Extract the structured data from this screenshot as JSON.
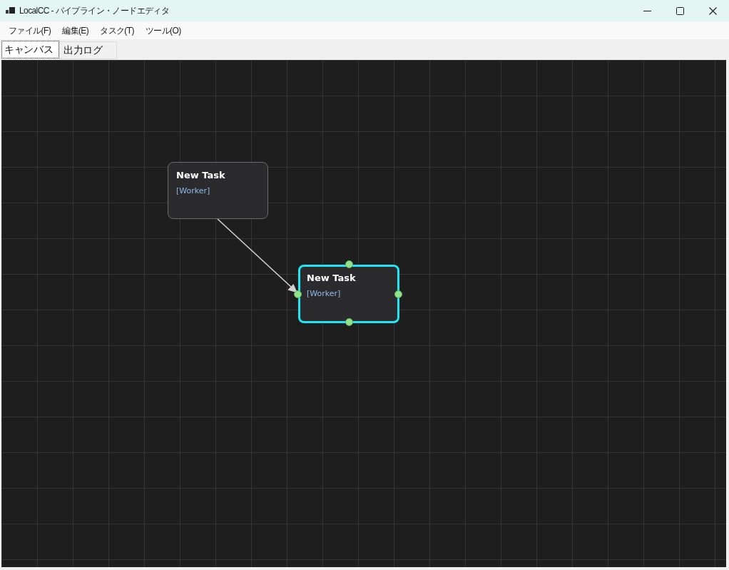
{
  "window": {
    "title": "LocalCC - パイプライン・ノードエディタ"
  },
  "menu": [
    {
      "label": "ファイル(F)"
    },
    {
      "label": "編集(E)"
    },
    {
      "label": "タスク(T)"
    },
    {
      "label": "ツール(O)"
    }
  ],
  "tabs": [
    {
      "label": "キャンバス",
      "selected": true
    },
    {
      "label": "出力ログ",
      "selected": false
    }
  ],
  "canvas": {
    "nodes": [
      {
        "title": "New Task",
        "role": "[Worker]",
        "selected": false
      },
      {
        "title": "New Task",
        "role": "[Worker]",
        "selected": true
      }
    ]
  }
}
